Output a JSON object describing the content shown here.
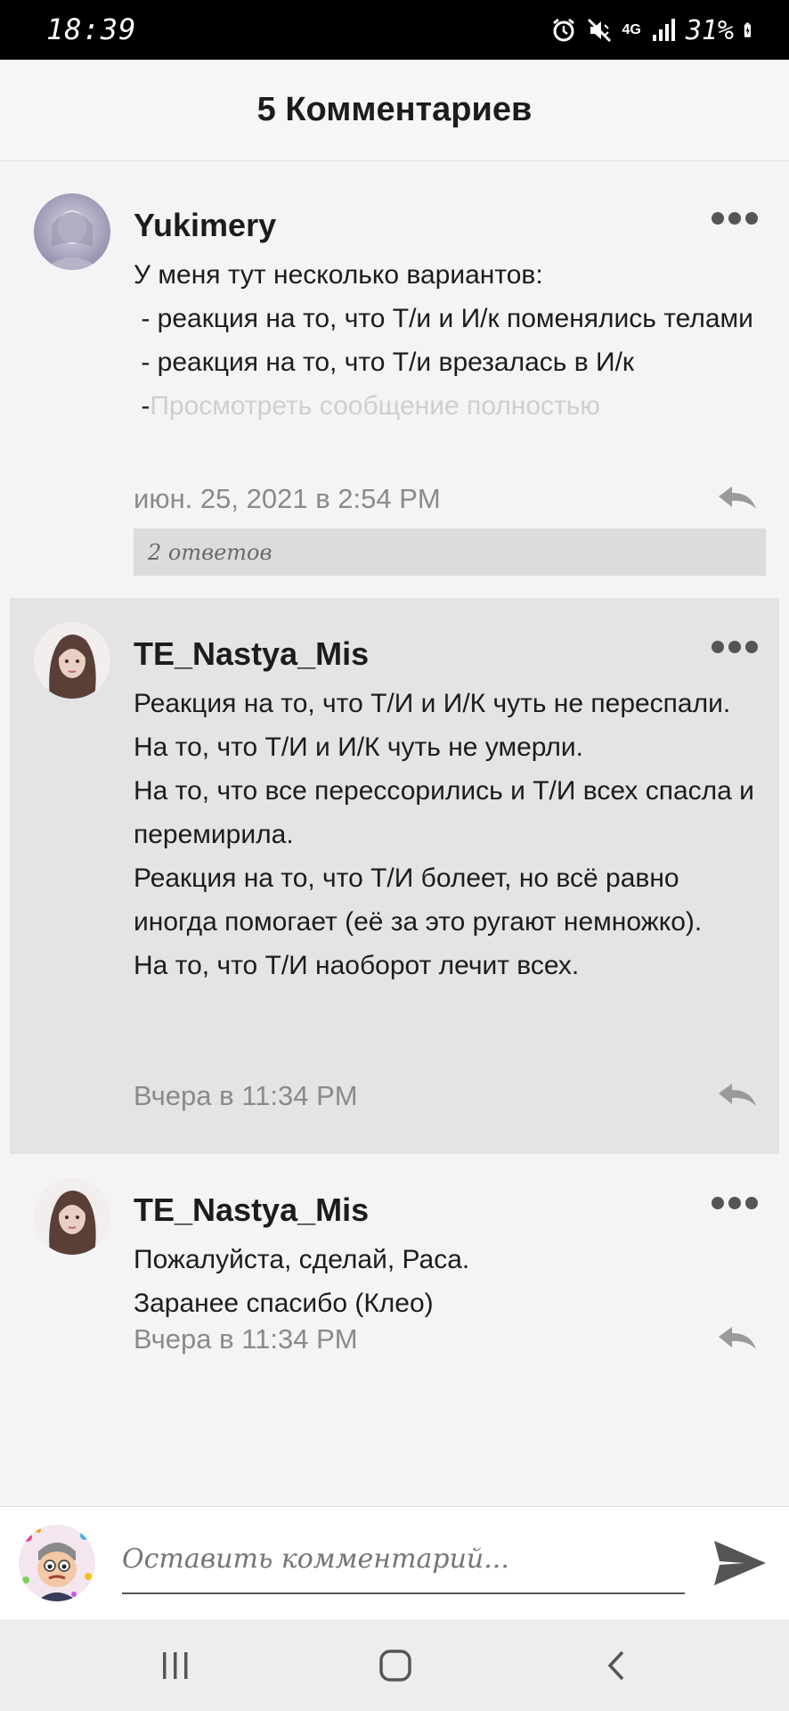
{
  "status_bar": {
    "time": "18:39",
    "network": "4G",
    "battery": "31%",
    "icons": [
      "alarm-icon",
      "mute-vibrate-icon",
      "mobile-data-icon",
      "signal-icon",
      "battery-charging-icon"
    ]
  },
  "header": {
    "title": "5 Комментариев"
  },
  "comments": [
    {
      "username": "Yukimery",
      "lines": [
        "У меня тут несколько вариантов:",
        " - реакция на то, что Т/и и И/к поменялись телами",
        " - реакция на то, что Т/и врезалась в И/к",
        " -"
      ],
      "more_link": "Просмотреть сообщение полностью",
      "date": "июн. 25, 2021 в 2:54 PM",
      "replies": "2 ответов"
    },
    {
      "username": "TE_Nastya_Mis",
      "lines": [
        "Реакция на то, что Т/И и И/К чуть не переспали.",
        "На то, что Т/И и И/К чуть не умерли.",
        "На то, что все перессорились и Т/И всех спасла и перемирила.",
        "Реакция на то, что Т/И болеет, но всё равно иногда помогает (её за это ругают немножко).",
        "На то, что Т/И наоборот лечит всех."
      ],
      "date": "Вчера в 11:34 PM"
    },
    {
      "username": "TE_Nastya_Mis",
      "lines": [
        "Пожалуйста, сделай, Раса.",
        "Заранее спасибо (Клео)"
      ],
      "date": "Вчера в 11:34 PM"
    }
  ],
  "compose": {
    "placeholder": "Оставить комментарий..."
  },
  "nav": {
    "icons": [
      "recent-apps-icon",
      "home-icon",
      "back-icon"
    ]
  },
  "colors": {
    "highlight": "#e4e3e6",
    "card": "#f4f3f6",
    "meta": "#8a8a8a"
  }
}
